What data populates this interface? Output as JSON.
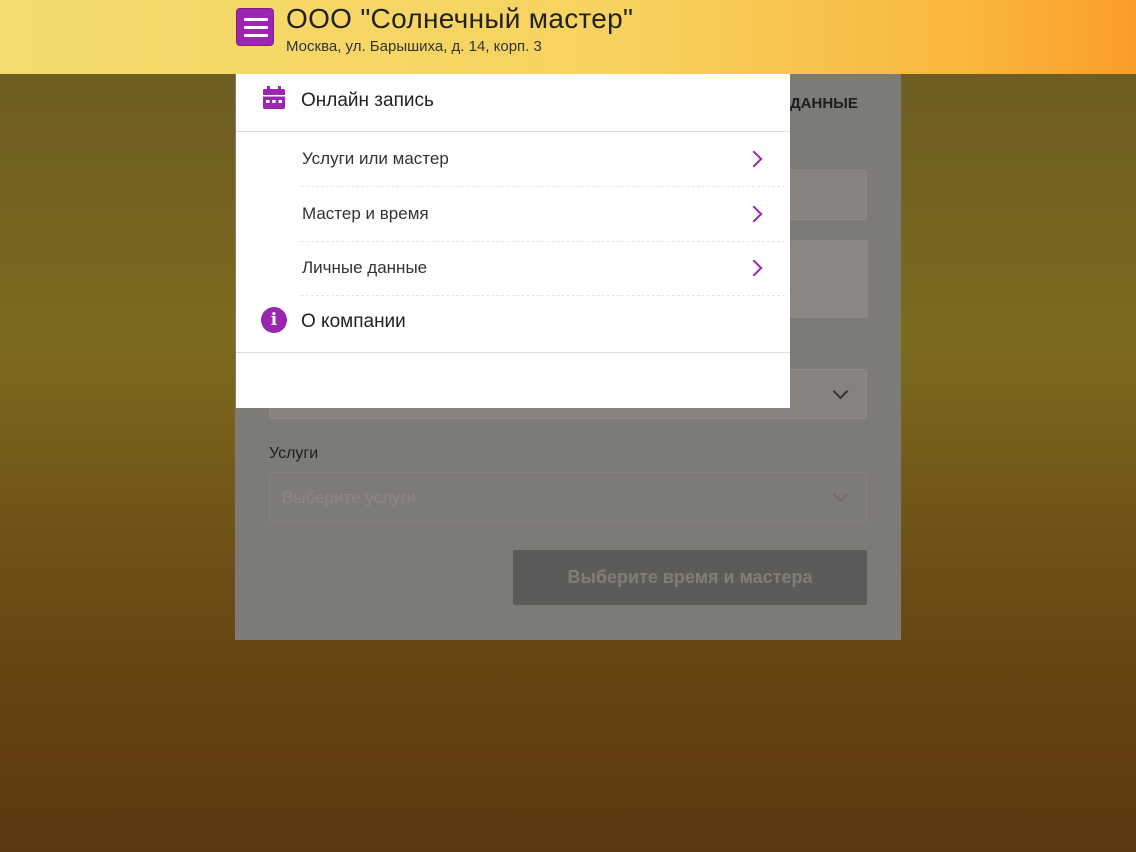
{
  "header": {
    "company_name": "ООО \"Солнечный мастер\"",
    "company_address": "Москва, ул. Барышиха, д. 14, корп. 3",
    "menu_icon": "hamburger-menu-icon"
  },
  "menu": {
    "online_booking": {
      "label": "Онлайн запись",
      "icon": "calendar-icon"
    },
    "items": [
      {
        "label": "Услуги или мастер",
        "icon": "chevron-right-icon"
      },
      {
        "label": "Мастер и время",
        "icon": "chevron-right-icon"
      },
      {
        "label": "Личные данные",
        "icon": "chevron-right-icon"
      }
    ],
    "about": {
      "label": "О компании",
      "icon": "info-icon"
    }
  },
  "background_form": {
    "active_tab_visible": "ДАННЫЕ",
    "services_label": "Услуги",
    "services_placeholder": "Выберите услуги",
    "submit_label": "Выберите время и мастера"
  },
  "colors": {
    "accent": "#9b27b0",
    "header_gradient_start": "#f5dc6e",
    "header_gradient_end": "#fb9e28"
  }
}
